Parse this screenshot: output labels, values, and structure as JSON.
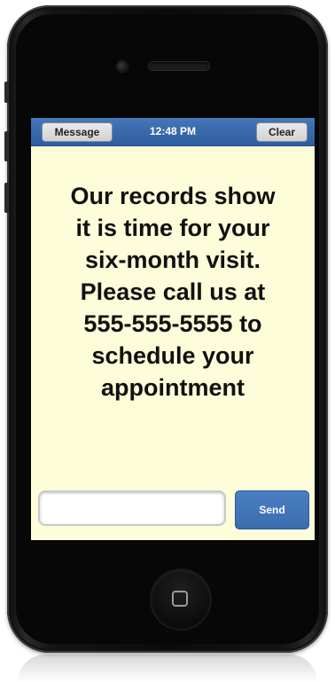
{
  "navbar": {
    "left_button": "Message",
    "time": "12:48 PM",
    "right_button": "Clear"
  },
  "message": {
    "lines": [
      "Our records show",
      "it is time for your",
      "six-month visit.",
      "Please call us at",
      "555-555-5555 to",
      "schedule your",
      "appointment"
    ]
  },
  "compose": {
    "input_value": "",
    "send_label": "Send"
  },
  "colors": {
    "navbar": "#3a69ab",
    "screen_background": "#fdfdd9",
    "send_button": "#3b6db0"
  }
}
